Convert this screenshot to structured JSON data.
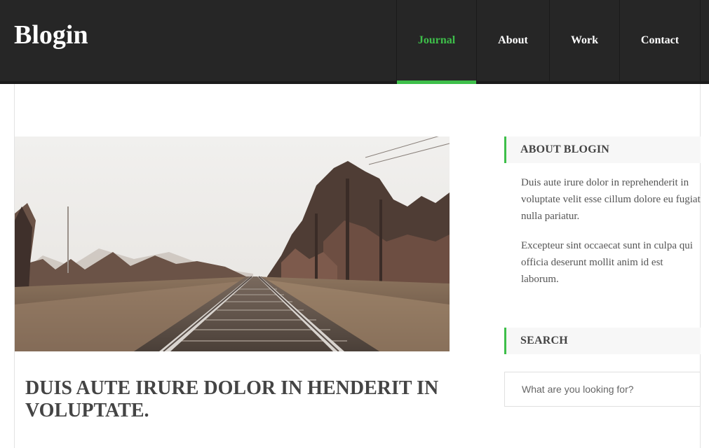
{
  "site": {
    "logo": "Blogin"
  },
  "nav": {
    "items": [
      {
        "label": "Journal",
        "active": true
      },
      {
        "label": "About",
        "active": false
      },
      {
        "label": "Work",
        "active": false
      },
      {
        "label": "Contact",
        "active": false
      }
    ]
  },
  "post": {
    "title": "DUIS AUTE IRURE DOLOR IN HENDERIT IN VOLUPTATE.",
    "image": "railway-tracks-photo"
  },
  "sidebar": {
    "about": {
      "heading": "ABOUT BLOGIN",
      "paragraphs": [
        "Duis aute irure dolor in reprehenderit in voluptate velit esse cillum dolore eu fugiat nulla pariatur.",
        "Excepteur sint occaecat sunt in culpa qui officia deserunt mollit anim id est laborum."
      ]
    },
    "search": {
      "heading": "SEARCH",
      "placeholder": "What are you looking for?"
    }
  },
  "colors": {
    "accent": "#3ebf4a",
    "header_bg": "#262626",
    "text": "#444444"
  }
}
